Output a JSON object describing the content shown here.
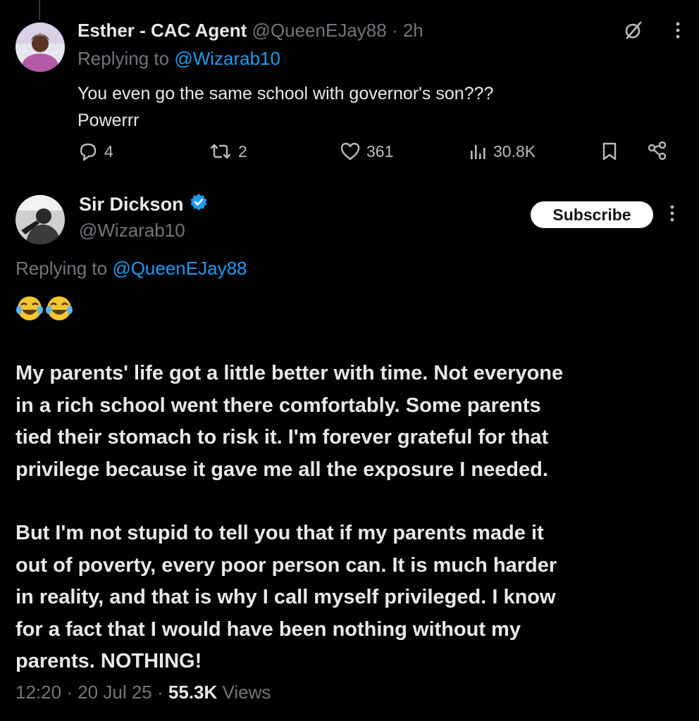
{
  "reply_tweet": {
    "author_name": "Esther - CAC Agent",
    "handle": "@QueenEJay88",
    "separator": "·",
    "time": "2h",
    "replying_to_label": "Replying to",
    "replying_to_handle": "@Wizarab10",
    "text_lines": [
      "You even go the same school with governor's son???",
      "Powerrr"
    ],
    "stats": {
      "replies": "4",
      "reposts": "2",
      "likes": "361",
      "views": "30.8K"
    }
  },
  "main_tweet": {
    "author_name": "Sir Dickson",
    "verified": true,
    "handle": "@Wizarab10",
    "subscribe_label": "Subscribe",
    "replying_to_label": "Replying to",
    "replying_to_handle": "@QueenEJay88",
    "emoji": "😂😂",
    "paragraph1": [
      "My parents' life got a little better with time. Not everyone",
      "in a rich school went there comfortably. Some parents",
      "tied their stomach to risk it. I'm forever grateful for that",
      "privilege because it gave me all the exposure I needed."
    ],
    "paragraph2": [
      "But I'm not stupid to tell you that if my parents made it",
      "out of poverty, every poor person can. It is much harder",
      "in reality, and that is why I call myself privileged. I know",
      "for a fact that I would have been nothing without my",
      "parents. NOTHING!"
    ],
    "time": "12:20",
    "date": "20 Jul 25",
    "separator": "·",
    "views_count": "55.3K",
    "views_label": "Views"
  },
  "colors": {
    "background": "#000000",
    "text": "#e7e9ea",
    "muted": "#71767b",
    "link": "#1d9bf0",
    "verified": "#1d9bf0"
  },
  "icons": [
    "reply-icon",
    "repost-icon",
    "like-icon",
    "views-icon",
    "bookmark-icon",
    "share-icon",
    "grok-icon",
    "more-icon",
    "verified-badge-icon"
  ]
}
